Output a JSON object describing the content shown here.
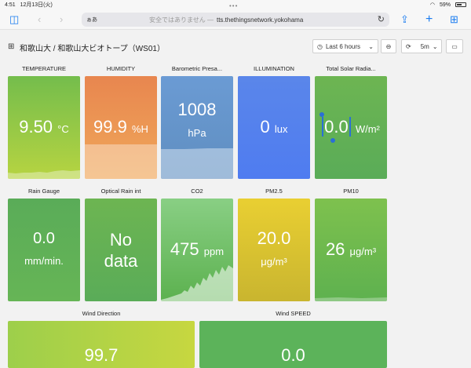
{
  "status": {
    "time": "4:51",
    "date": "12月13日(火)",
    "battery_pct": "59%"
  },
  "browser": {
    "aa": "ぁあ",
    "insecure": "安全ではありません —",
    "host": "tts.thethingsnetwork.yokohama"
  },
  "dashboard": {
    "breadcrumb": "和歌山大 / 和歌山大ビオトープ（WS01）",
    "time_range": "Last 6 hours",
    "refresh": "5m"
  },
  "panels": [
    {
      "title": "TEMPERATURE",
      "value": "9.50",
      "unit": "°C"
    },
    {
      "title": "HUMIDITY",
      "value": "99.9",
      "unit": "%H"
    },
    {
      "title": "Barometric Presa...",
      "value": "1008",
      "unit": "hPa"
    },
    {
      "title": "ILLUMINATION",
      "value": "0",
      "unit": "lux"
    },
    {
      "title": "Total Solar Radia...",
      "value": "0.0",
      "unit": "W/m²"
    },
    {
      "title": "Rain Gauge",
      "value": "0.0",
      "unit": "mm/min."
    },
    {
      "title": "Optical Rain int",
      "value": "No",
      "unit": "data"
    },
    {
      "title": "CO2",
      "value": "475",
      "unit": "ppm"
    },
    {
      "title": "PM2.5",
      "value": "20.0",
      "unit": "μg/m³"
    },
    {
      "title": "PM10",
      "value": "26",
      "unit": "μg/m³"
    },
    {
      "title": "Wind Direction",
      "value": "99.7",
      "unit": ""
    },
    {
      "title": "Wind SPEED",
      "value": "0.0",
      "unit": ""
    }
  ],
  "colors": {
    "accent": "#1a7cf0"
  }
}
